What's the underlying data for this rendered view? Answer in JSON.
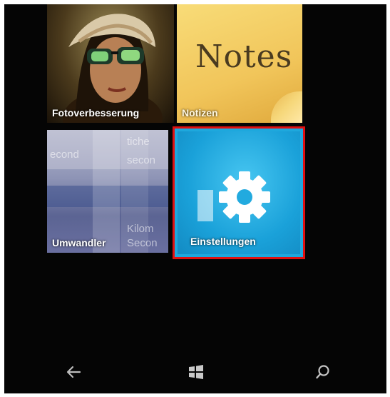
{
  "tiles": {
    "photo": {
      "label": "Fotoverbesserung"
    },
    "notes": {
      "label": "Notizen",
      "heading": "Notes"
    },
    "converter": {
      "label": "Umwandler",
      "background_words": [
        "econd",
        "tiche",
        "secon",
        "Kilom",
        "Secon"
      ]
    },
    "settings": {
      "label": "Einstellungen",
      "selected": true
    }
  },
  "navbar": {
    "back_icon": "back-arrow-icon",
    "start_icon": "windows-logo-icon",
    "search_icon": "search-icon"
  },
  "colors": {
    "background": "#050505",
    "settings_tile": "#1ea8dd",
    "notes_tile": "#f1c55a",
    "selection_border": "#e01010"
  }
}
